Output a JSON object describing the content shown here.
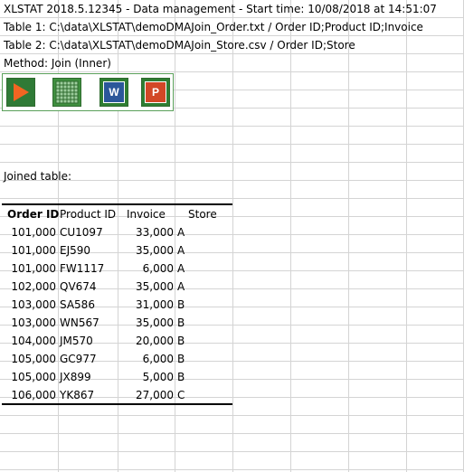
{
  "header": {
    "line1": "XLSTAT 2018.5.12345 - Data management - Start time: 10/08/2018 at 14:51:07",
    "line2": "Table 1: C:\\data\\XLSTAT\\demoDMAJoin_Order.txt / Order ID;Product ID;Invoice",
    "line3": "Table 2: C:\\data\\XLSTAT\\demoDMAJoin_Store.csv / Order ID;Store",
    "line4": "Method: Join (Inner)"
  },
  "toolbar": {
    "buttons": [
      {
        "icon": "play-icon",
        "color": "#f26522"
      },
      {
        "icon": "spreadsheet-icon",
        "color": "#3f8f3f"
      },
      {
        "icon": "word-icon",
        "label": "W",
        "color": "#2b579a"
      },
      {
        "icon": "powerpoint-icon",
        "label": "P",
        "color": "#d24726"
      }
    ]
  },
  "joined_label": "Joined table:",
  "table": {
    "columns": [
      "Order ID",
      "Product ID",
      "Invoice",
      "Store"
    ],
    "rows": [
      [
        "101,000",
        "CU1097",
        "33,000",
        "A"
      ],
      [
        "101,000",
        "EJ590",
        "35,000",
        "A"
      ],
      [
        "101,000",
        "FW1117",
        "6,000",
        "A"
      ],
      [
        "102,000",
        "QV674",
        "35,000",
        "A"
      ],
      [
        "103,000",
        "SA586",
        "31,000",
        "B"
      ],
      [
        "103,000",
        "WN567",
        "35,000",
        "B"
      ],
      [
        "104,000",
        "JM570",
        "20,000",
        "B"
      ],
      [
        "105,000",
        "GC977",
        "6,000",
        "B"
      ],
      [
        "105,000",
        "JX899",
        "5,000",
        "B"
      ],
      [
        "106,000",
        "YK867",
        "27,000",
        "C"
      ]
    ]
  }
}
